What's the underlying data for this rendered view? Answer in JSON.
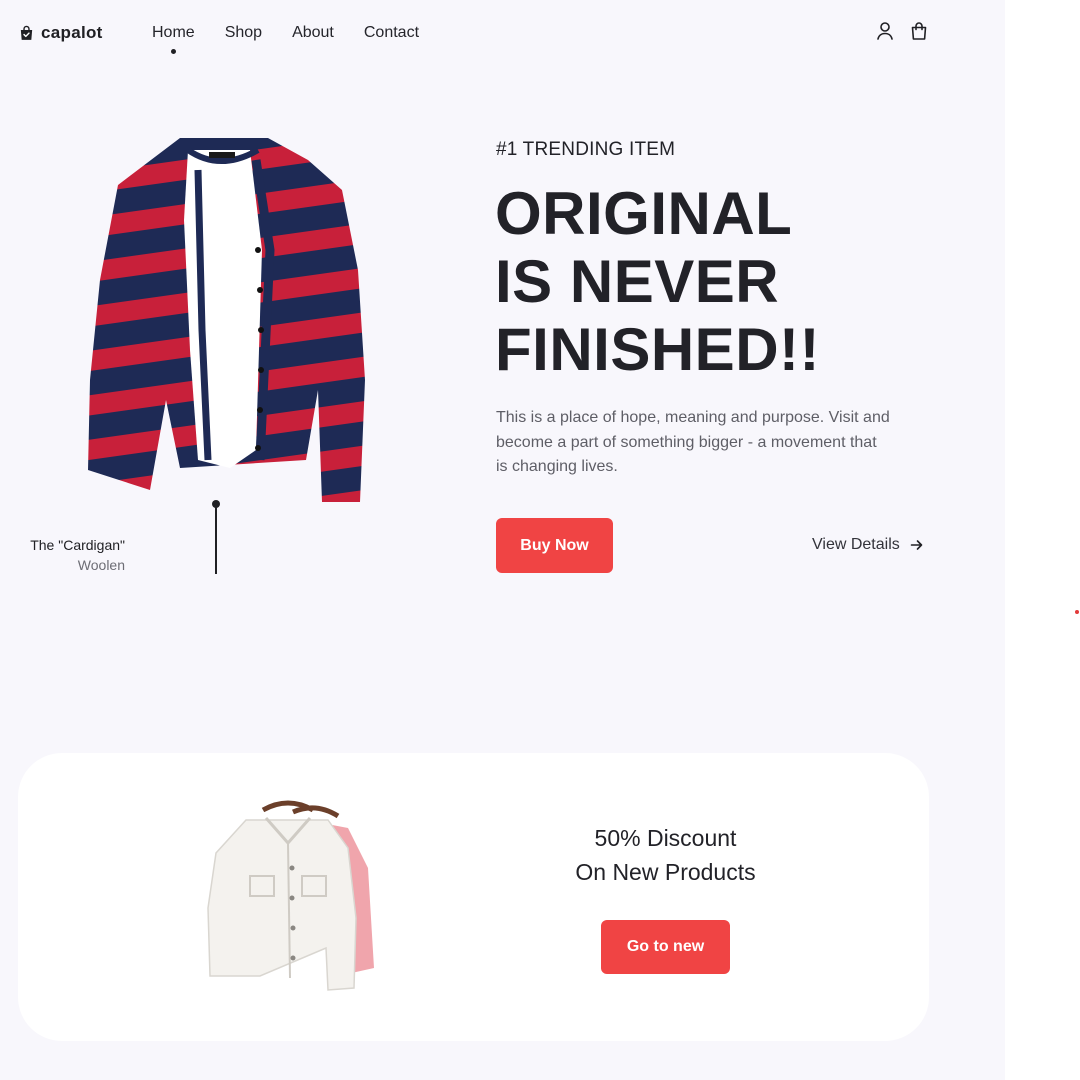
{
  "brand": {
    "name": "capalot",
    "icon": "shopping-bag-check-icon"
  },
  "nav": {
    "items": [
      {
        "label": "Home",
        "active": true
      },
      {
        "label": "Shop",
        "active": false
      },
      {
        "label": "About",
        "active": false
      },
      {
        "label": "Contact",
        "active": false
      }
    ],
    "icons": [
      "user-icon",
      "shopping-bag-icon"
    ]
  },
  "hero": {
    "eyebrow": "#1 TRENDING ITEM",
    "headline": [
      "ORIGINAL",
      "IS NEVER",
      "FINISHED!!"
    ],
    "description": "This is a place of hope, meaning and purpose. Visit and become a part of something bigger - a movement that is changing lives.",
    "primary_button": "Buy Now",
    "secondary_link": "View Details",
    "secondary_icon": "arrow-right-icon",
    "product": {
      "image": "striped-cardigan-image",
      "name": "The \"Cardigan\"",
      "material": "Woolen"
    }
  },
  "promo": {
    "title_lines": [
      "50% Discount",
      "On New Products"
    ],
    "button": "Go to new",
    "image": "denim-jackets-image"
  },
  "colors": {
    "accent": "#f04444",
    "text": "#222228",
    "muted": "#5e5e66",
    "page_bg": "#f8f7fc",
    "card_bg": "#ffffff"
  }
}
